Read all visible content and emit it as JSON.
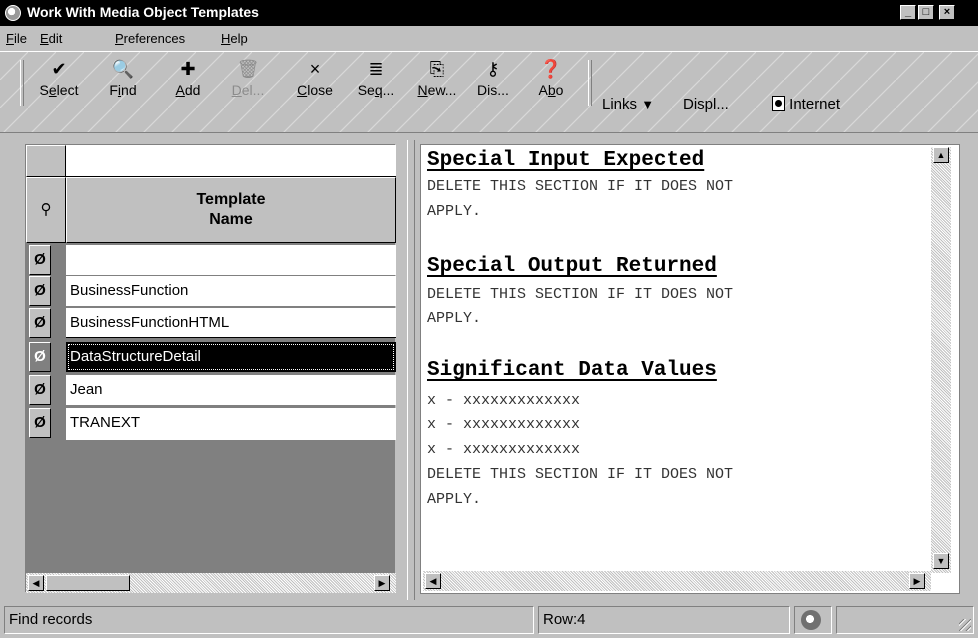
{
  "window": {
    "title": "Work With Media Object Templates",
    "min": "_",
    "max": "□",
    "close": "×"
  },
  "menu": [
    {
      "ul": "F",
      "rest": "ile"
    },
    {
      "ul": "E",
      "rest": "dit"
    },
    {
      "ul": "P",
      "rest": "references"
    },
    {
      "ul": "H",
      "rest": "elp"
    }
  ],
  "toolbar": {
    "buttons": [
      {
        "pre": "S",
        "ul": "e",
        "post": "lect",
        "icon": "✔"
      },
      {
        "pre": "F",
        "ul": "i",
        "post": "nd",
        "icon": "🔍"
      },
      {
        "pre": "",
        "ul": "A",
        "post": "dd",
        "icon": "✚"
      },
      {
        "pre": "",
        "ul": "D",
        "post": "el...",
        "icon": "🗑"
      },
      {
        "pre": "",
        "ul": "C",
        "post": "lose",
        "icon": "×"
      },
      {
        "pre": "Se",
        "ul": "q",
        "post": "...",
        "icon": "≣"
      },
      {
        "pre": "",
        "ul": "N",
        "post": "ew...",
        "icon": "⎘"
      },
      {
        "pre": "Dis...",
        "ul": "",
        "post": "",
        "icon": "⚷"
      },
      {
        "pre": "A",
        "ul": "b",
        "post": "o",
        "icon": "❓"
      }
    ],
    "links_label": "Links",
    "displ_label": "Displ...",
    "internet_label": "Internet"
  },
  "grid": {
    "header_label_line1": "Template",
    "header_label_line2": "Name",
    "header_icon": "binoculars-icon",
    "rows": [
      "",
      "BusinessFunction",
      "BusinessFunctionHTML",
      "DataStructureDetail",
      "Jean",
      "TRANEXT"
    ],
    "selected_index": 3,
    "row_icon": "Ø"
  },
  "document": {
    "sections": [
      {
        "heading": "Special Input Expected",
        "lines": [
          "DELETE THIS SECTION IF IT DOES NOT",
          "APPLY."
        ]
      },
      {
        "heading": "Special Output Returned",
        "lines": [
          "DELETE THIS SECTION IF IT DOES NOT",
          "APPLY."
        ]
      },
      {
        "heading": "Significant Data Values",
        "lines": [
          "x - xxxxxxxxxxxxx",
          "x - xxxxxxxxxxxxx",
          "x - xxxxxxxxxxxxx",
          "DELETE THIS SECTION IF IT DOES NOT",
          "APPLY."
        ]
      }
    ]
  },
  "status": {
    "message": "Find records",
    "row": "Row:4"
  },
  "colors": {
    "selection": "#000000",
    "window_bg": "#c0c0c0",
    "grid_empty": "#808080"
  }
}
